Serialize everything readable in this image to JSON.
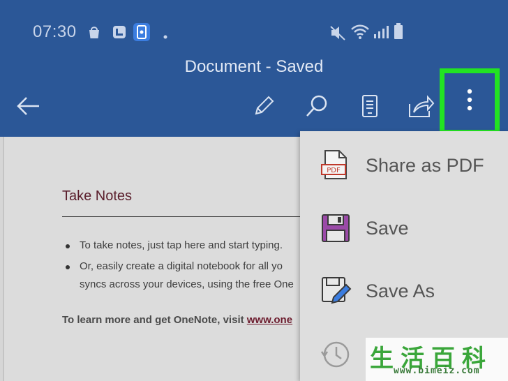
{
  "status_bar": {
    "time": "07:30",
    "left_icons": [
      "shopping-bag-icon",
      "gallery-icon",
      "app-notification-icon",
      "dot-icon"
    ],
    "right_icons": [
      "mute-icon",
      "wifi-icon",
      "signal-icon",
      "battery-icon"
    ]
  },
  "header": {
    "title": "Document - Saved"
  },
  "toolbar": {
    "buttons": [
      "back-arrow-icon",
      "pencil-icon",
      "search-icon",
      "reading-view-icon",
      "share-icon",
      "more-options-icon"
    ]
  },
  "document": {
    "heading": "Take Notes",
    "bullets": [
      "To take notes, just tap here and start typing.",
      "Or, easily create a digital notebook for all yo",
      "syncs across your devices, using the free One"
    ],
    "footer_text": "To learn more and get OneNote, visit ",
    "footer_link": "www.one"
  },
  "menu": {
    "items": [
      {
        "label": "Share as PDF",
        "icon": "pdf-icon"
      },
      {
        "label": "Save",
        "icon": "save-icon"
      },
      {
        "label": "Save As",
        "icon": "save-as-icon"
      },
      {
        "label": "",
        "icon": "history-icon"
      }
    ]
  },
  "watermark": {
    "chars": "生活百科",
    "url": "www.bimeiz.com"
  },
  "colors": {
    "header_bg": "#2b5797",
    "highlight": "#22e322",
    "save_icon": "#9b4aa8"
  }
}
